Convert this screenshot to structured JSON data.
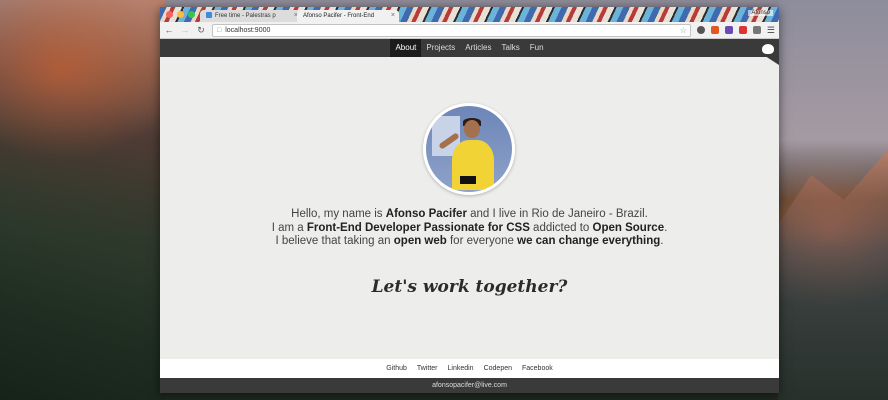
{
  "browser": {
    "tabs": [
      {
        "title": "Free time - Palestras p",
        "active": false
      },
      {
        "title": "Afonso Pacifer - Front-End",
        "active": true
      }
    ],
    "profile_name": "Afonso",
    "url": "localhost:9000",
    "icons": {
      "back": "arrow-left-icon",
      "forward": "arrow-right-icon",
      "reload": "reload-icon",
      "star": "star-icon",
      "menu": "hamburger-icon"
    }
  },
  "nav": {
    "items": [
      {
        "label": "About",
        "active": true
      },
      {
        "label": "Projects",
        "active": false
      },
      {
        "label": "Articles",
        "active": false
      },
      {
        "label": "Talks",
        "active": false
      },
      {
        "label": "Fun",
        "active": false
      }
    ]
  },
  "bio": {
    "line1_a": "Hello, my name is ",
    "line1_name": "Afonso Pacifer",
    "line1_b": " and I live in Rio de Janeiro - Brazil.",
    "line2_a": "I am a ",
    "line2_role": "Front-End Developer Passionate for CSS",
    "line2_b": " addicted to ",
    "line2_os": "Open Source",
    "line2_c": ".",
    "line3_a": "I believe that taking an ",
    "line3_web": "open web",
    "line3_b": " for everyone ",
    "line3_change": "we can change everything",
    "line3_c": "."
  },
  "cta": "Let's work together?",
  "footer": {
    "links": [
      "Github",
      "Twitter",
      "Linkedin",
      "Codepen",
      "Facebook"
    ],
    "email": "afonsopacifer@live.com"
  },
  "colors": {
    "nav_bg": "#3a3a3a",
    "page_bg": "#ededec",
    "accent_yellow": "#f2d335"
  }
}
